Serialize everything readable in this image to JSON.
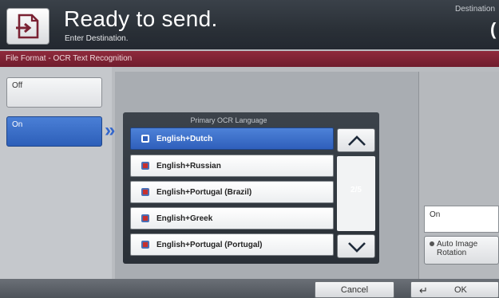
{
  "header": {
    "title": "Ready to send.",
    "subtitle": "Enter Destination.",
    "destination_label": "Destination",
    "destination_value": "(",
    "icon": "send-document-icon"
  },
  "section": {
    "title": "File Format - OCR Text Recognition"
  },
  "options": {
    "off_label": "Off",
    "on_label": "On",
    "selected": "On"
  },
  "language_panel": {
    "title": "Primary OCR Language",
    "items": [
      {
        "label": "English+Dutch",
        "selected": true
      },
      {
        "label": "English+Russian",
        "selected": false
      },
      {
        "label": "English+Portugal (Brazil)",
        "selected": false
      },
      {
        "label": "English+Greek",
        "selected": false
      },
      {
        "label": "English+Portugal (Portugal)",
        "selected": false
      }
    ],
    "page_indicator": "2/5",
    "scroll_up_icon": "chevron-up-icon",
    "scroll_down_icon": "chevron-down-icon"
  },
  "right_column": {
    "status_value": "On",
    "auto_rotation_label": "Auto Image Rotation"
  },
  "footer": {
    "cancel_label": "Cancel",
    "ok_label": "OK"
  },
  "colors": {
    "accent_blue": "#3366cc",
    "section_bar": "#7a2233"
  }
}
